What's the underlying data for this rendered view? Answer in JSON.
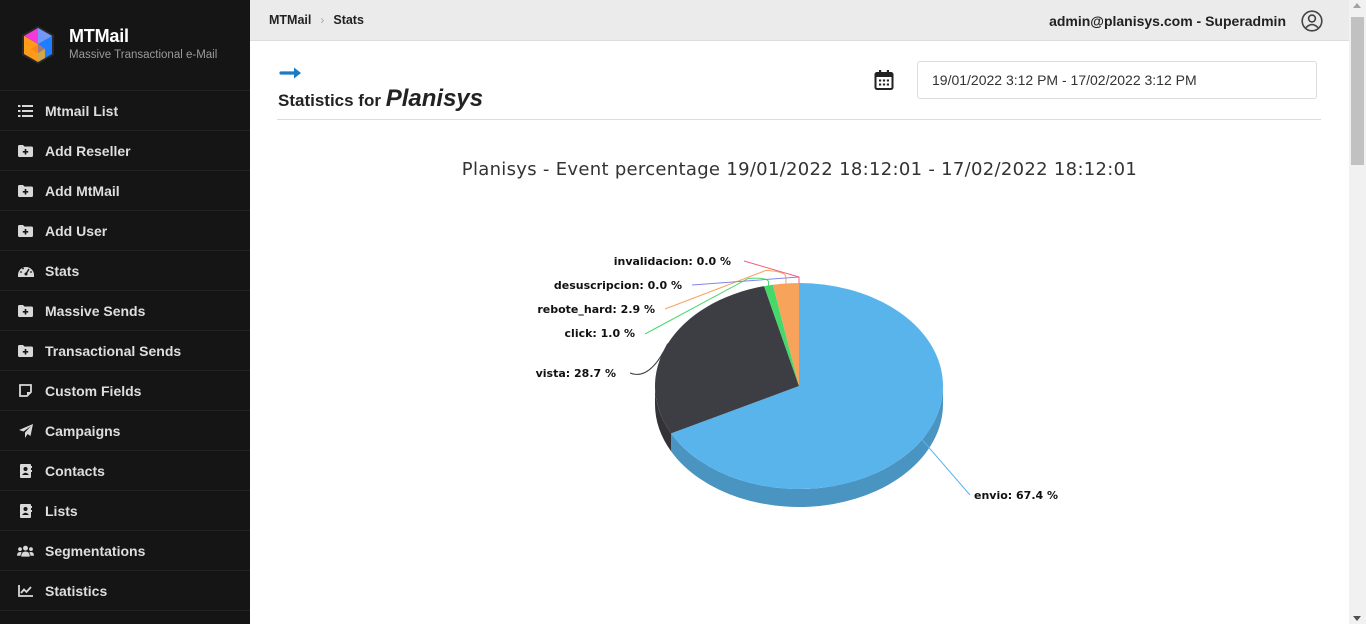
{
  "brand": {
    "title": "MTMail",
    "subtitle": "Massive Transactional e-Mail"
  },
  "sidebar": {
    "items": [
      {
        "label": "Mtmail List",
        "icon": "list-icon"
      },
      {
        "label": "Add Reseller",
        "icon": "folder-plus-icon"
      },
      {
        "label": "Add MtMail",
        "icon": "folder-plus-icon"
      },
      {
        "label": "Add User",
        "icon": "folder-plus-icon"
      },
      {
        "label": "Stats",
        "icon": "gauge-icon"
      },
      {
        "label": "Massive Sends",
        "icon": "folder-plus-icon"
      },
      {
        "label": "Transactional Sends",
        "icon": "folder-plus-icon"
      },
      {
        "label": "Custom Fields",
        "icon": "sticky-note-icon"
      },
      {
        "label": "Campaigns",
        "icon": "paper-plane-icon"
      },
      {
        "label": "Contacts",
        "icon": "address-book-icon"
      },
      {
        "label": "Lists",
        "icon": "address-book-icon"
      },
      {
        "label": "Segmentations",
        "icon": "users-icon"
      },
      {
        "label": "Statistics",
        "icon": "line-chart-icon"
      }
    ]
  },
  "breadcrumb": {
    "items": [
      "MTMail",
      "Stats"
    ],
    "separator": "›"
  },
  "user": {
    "label": "admin@planisys.com - Superadmin"
  },
  "page": {
    "title_prefix": "Statistics for",
    "org_name": "Planisys"
  },
  "date_range": {
    "value": "19/01/2022 3:12 PM - 17/02/2022 3:12 PM"
  },
  "colors": {
    "sidebar_bg": "#151515",
    "accent": "#1a7ac4"
  },
  "chart_data": {
    "type": "pie",
    "title": "Planisys - Event percentage 19/01/2022 18:12:01 - 17/02/2022 18:12:01",
    "three_d": true,
    "slices": [
      {
        "name": "envio",
        "value": 67.4,
        "label": "envio: 67.4 %",
        "color": "#5ab4ec"
      },
      {
        "name": "vista",
        "value": 28.7,
        "label": "vista: 28.7 %",
        "color": "#3d3d44"
      },
      {
        "name": "click",
        "value": 1.0,
        "label": "click: 1.0 %",
        "color": "#47d86a"
      },
      {
        "name": "rebote_hard",
        "value": 2.9,
        "label": "rebote_hard: 2.9 %",
        "color": "#f7a35c"
      },
      {
        "name": "desuscripcion",
        "value": 0.0,
        "label": "desuscripcion: 0.0 %",
        "color": "#8085e9"
      },
      {
        "name": "invalidacion",
        "value": 0.0,
        "label": "invalidacion: 0.0 %",
        "color": "#f15c80"
      }
    ]
  }
}
